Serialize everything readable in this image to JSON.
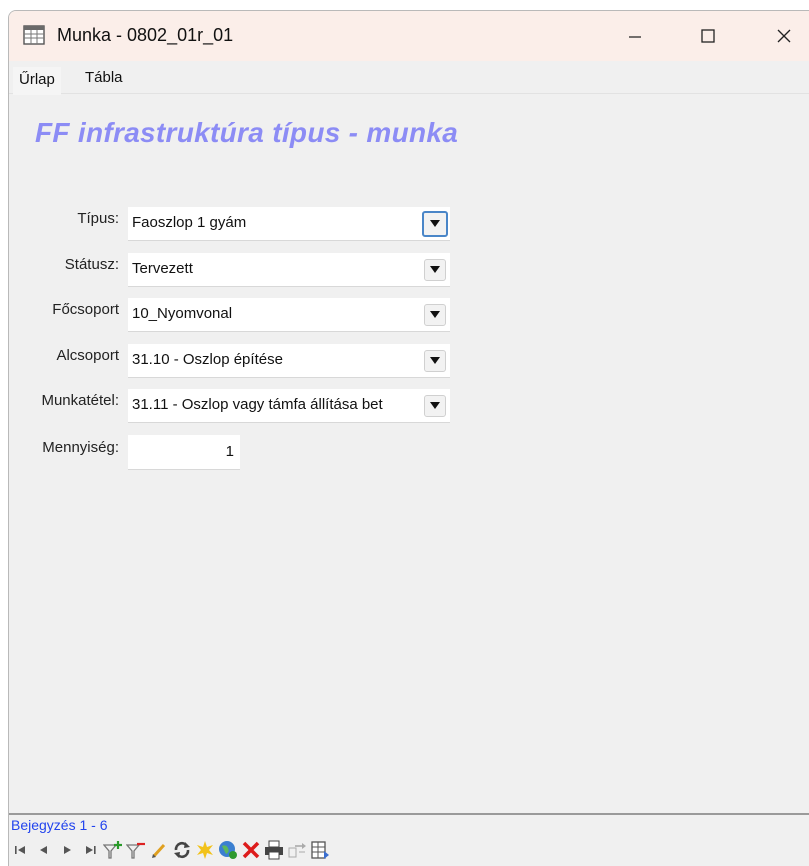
{
  "window": {
    "title": "Munka - 0802_01r_01",
    "icon": "table-form-icon"
  },
  "tabs": [
    {
      "label": "Űrlap",
      "active": true
    },
    {
      "label": "Tábla",
      "active": false
    }
  ],
  "form": {
    "title": "FF infrastruktúra típus - munka",
    "fields": {
      "tipus": {
        "label": "Típus:",
        "value": "Faoszlop 1 gyám"
      },
      "statusz": {
        "label": "Státusz:",
        "value": "Tervezett"
      },
      "focsoport": {
        "label": "Főcsoport",
        "value": "10_Nyomvonal"
      },
      "alcsoport": {
        "label": "Alcsoport",
        "value": "31.10 - Oszlop építése"
      },
      "munkatetel": {
        "label": "Munkatétel:",
        "value": "31.11 - Oszlop vagy támfa állítása bet"
      },
      "mennyiseg": {
        "label": "Mennyiség:",
        "value": "1"
      }
    }
  },
  "status": {
    "records": "Bejegyzés 1 - 6"
  },
  "toolbar": {
    "icons": [
      "first-record-icon",
      "prev-record-icon",
      "next-record-icon",
      "last-record-icon",
      "add-filter-icon",
      "remove-filter-icon",
      "edit-pencil-icon",
      "refresh-icon",
      "new-record-icon",
      "globe-icon",
      "delete-icon",
      "print-icon",
      "export-icon",
      "table-view-icon"
    ]
  },
  "colors": {
    "title_accent": "#8c8cf5",
    "record_link": "#2244ee",
    "focus_border": "#4a86c8"
  }
}
